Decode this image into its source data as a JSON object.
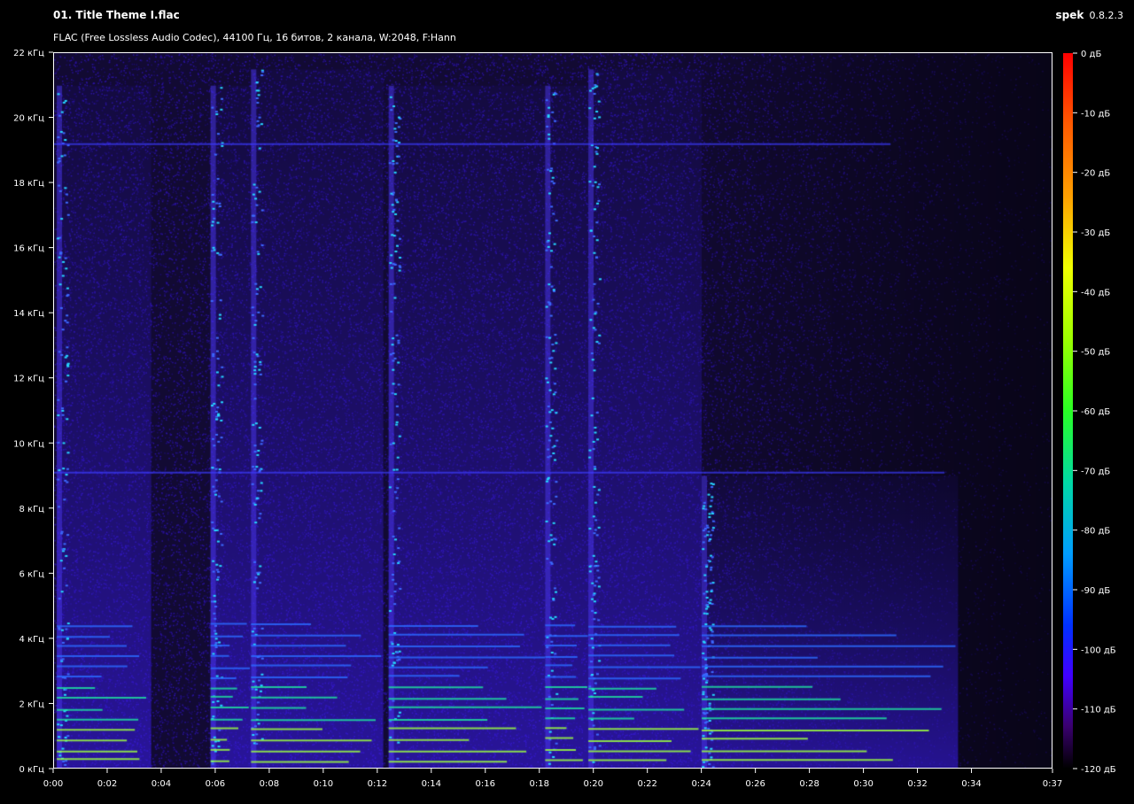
{
  "header": {
    "title": "01. Title Theme I.flac",
    "subtitle": "FLAC (Free Lossless Audio Codec), 44100 Гц, 16 битов, 2 канала, W:2048, F:Hann",
    "app_name": "spek",
    "app_version": "0.8.2.3"
  },
  "chart_data": {
    "type": "heatmap",
    "title": "01. Title Theme I.flac",
    "xlabel": "",
    "ylabel": "",
    "x_range_seconds": [
      0,
      37
    ],
    "y_range_khz": [
      0,
      22
    ],
    "x_ticks": [
      {
        "t": 0,
        "label": "0:00"
      },
      {
        "t": 2,
        "label": "0:02"
      },
      {
        "t": 4,
        "label": "0:04"
      },
      {
        "t": 6,
        "label": "0:06"
      },
      {
        "t": 8,
        "label": "0:08"
      },
      {
        "t": 10,
        "label": "0:10"
      },
      {
        "t": 12,
        "label": "0:12"
      },
      {
        "t": 14,
        "label": "0:14"
      },
      {
        "t": 16,
        "label": "0:16"
      },
      {
        "t": 18,
        "label": "0:18"
      },
      {
        "t": 20,
        "label": "0:20"
      },
      {
        "t": 22,
        "label": "0:22"
      },
      {
        "t": 24,
        "label": "0:24"
      },
      {
        "t": 26,
        "label": "0:26"
      },
      {
        "t": 28,
        "label": "0:28"
      },
      {
        "t": 30,
        "label": "0:30"
      },
      {
        "t": 32,
        "label": "0:32"
      },
      {
        "t": 34,
        "label": "0:34"
      },
      {
        "t": 37,
        "label": "0:37"
      }
    ],
    "y_ticks": [
      {
        "f": 0,
        "label": "0 кГц"
      },
      {
        "f": 2,
        "label": "2 кГц"
      },
      {
        "f": 4,
        "label": "4 кГц"
      },
      {
        "f": 6,
        "label": "6 кГц"
      },
      {
        "f": 8,
        "label": "8 кГц"
      },
      {
        "f": 10,
        "label": "10 кГц"
      },
      {
        "f": 12,
        "label": "12 кГц"
      },
      {
        "f": 14,
        "label": "14 кГц"
      },
      {
        "f": 16,
        "label": "16 кГц"
      },
      {
        "f": 18,
        "label": "18 кГц"
      },
      {
        "f": 20,
        "label": "20 кГц"
      },
      {
        "f": 22,
        "label": "22 кГц"
      }
    ],
    "colorbar": {
      "range_db": [
        -120,
        0
      ],
      "ticks": [
        {
          "db": 0,
          "label": "0 дБ"
        },
        {
          "db": -10,
          "label": "-10 дБ"
        },
        {
          "db": -20,
          "label": "-20 дБ"
        },
        {
          "db": -30,
          "label": "-30 дБ"
        },
        {
          "db": -40,
          "label": "-40 дБ"
        },
        {
          "db": -50,
          "label": "-50 дБ"
        },
        {
          "db": -60,
          "label": "-60 дБ"
        },
        {
          "db": -70,
          "label": "-70 дБ"
        },
        {
          "db": -80,
          "label": "-80 дБ"
        },
        {
          "db": -90,
          "label": "-90 дБ"
        },
        {
          "db": -100,
          "label": "-100 дБ"
        },
        {
          "db": -110,
          "label": "-110 дБ"
        },
        {
          "db": -120,
          "label": "-120 дБ"
        }
      ]
    },
    "onsets": [
      {
        "t_start": 0.1,
        "t_end": 3.6,
        "max_khz": 21
      },
      {
        "t_start": 5.8,
        "t_end": 7.3,
        "max_khz": 21
      },
      {
        "t_start": 7.3,
        "t_end": 12.2,
        "max_khz": 21.5
      },
      {
        "t_start": 12.4,
        "t_end": 18.2,
        "max_khz": 21
      },
      {
        "t_start": 18.2,
        "t_end": 19.8,
        "max_khz": 21
      },
      {
        "t_start": 19.8,
        "t_end": 24.0,
        "max_khz": 21.5
      },
      {
        "t_start": 24.0,
        "t_end": 33.5,
        "max_khz": 9
      }
    ],
    "horizontal_lines_khz": [
      19.2,
      9.1
    ],
    "colors": {
      "background": "#120a33",
      "low": "#2a00c8",
      "mid": "#00e0a0",
      "high": "#aaff00"
    }
  }
}
